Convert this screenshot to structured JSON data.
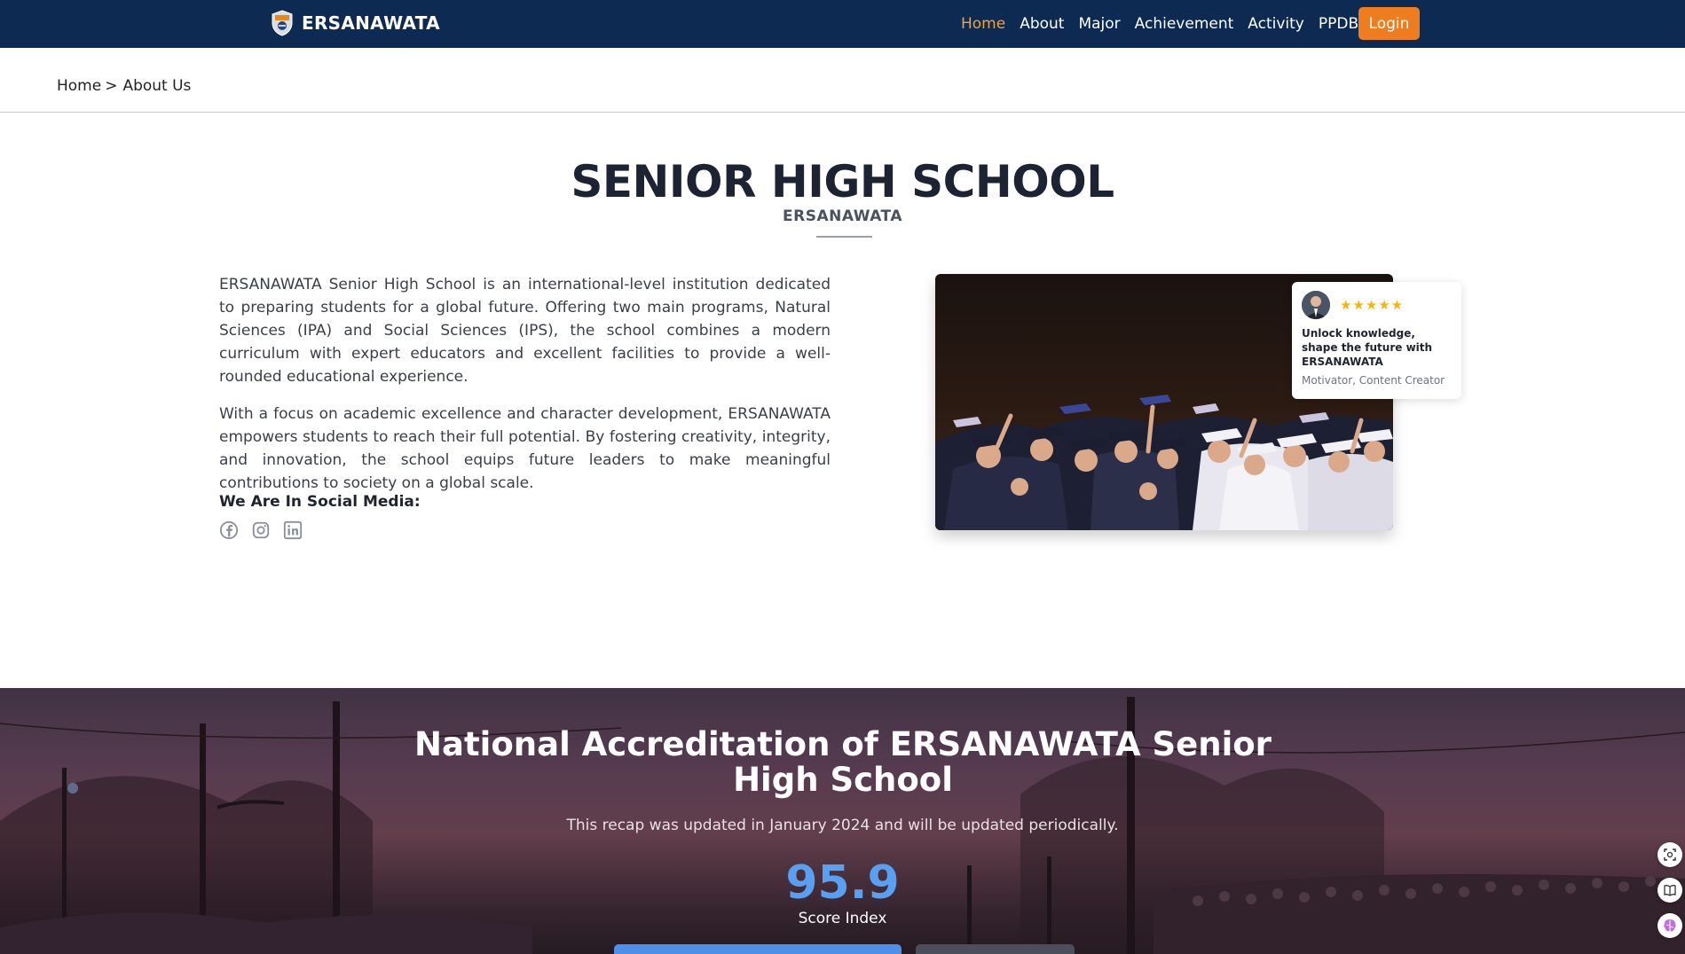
{
  "navbar": {
    "brand": "ERSANAWATA",
    "links": [
      {
        "label": "Home",
        "active": true
      },
      {
        "label": "About",
        "active": false
      },
      {
        "label": "Major",
        "active": false
      },
      {
        "label": "Achievement",
        "active": false
      },
      {
        "label": "Activity",
        "active": false
      },
      {
        "label": "PPDB",
        "active": false
      }
    ],
    "login_label": "Login"
  },
  "breadcrumb": {
    "home": "Home",
    "separator": ">",
    "current": "About Us"
  },
  "hero": {
    "title": "SENIOR HIGH SCHOOL",
    "subtitle": "ERSANAWATA",
    "paragraphs": [
      "ERSANAWATA Senior High School is an international-level institution dedicated to preparing students for a global future. Offering two main programs, Natural Sciences (IPA) and Social Sciences (IPS), the school combines a modern curriculum with expert educators and excellent facilities to provide a well-rounded educational experience.",
      "With a focus on academic excellence and character development, ERSANAWATA empowers students to reach their full potential. By fostering creativity, integrity, and innovation, the school equips future leaders to make meaningful contributions to society on a global scale."
    ],
    "social_heading": "We Are In Social Media:",
    "social_icons": [
      "facebook-icon",
      "instagram-icon",
      "linkedin-icon"
    ]
  },
  "testimonial": {
    "stars": "★★★★★",
    "rating": 5,
    "quote": "Unlock knowledge, shape the future with ERSANAWATA",
    "role": "Motivator, Content Creator"
  },
  "accreditation": {
    "title": "National Accreditation of ERSANAWATA Senior High School",
    "subtitle": "This recap was updated in January 2024 and will be updated periodically.",
    "score": "95.9",
    "score_label": "Score Index"
  },
  "colors": {
    "navbar_bg": "#0d2a52",
    "active_link": "#f2a23a",
    "login_bg": "#ee7d1f",
    "score": "#5aa0f2"
  }
}
